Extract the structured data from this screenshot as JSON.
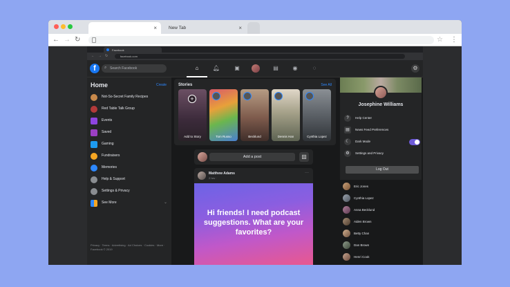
{
  "outer_browser": {
    "tabs": [
      {
        "label": ""
      },
      {
        "label": "New Tab"
      }
    ]
  },
  "inner_browser": {
    "tab_label": "Facebook",
    "url": "facebook.com"
  },
  "header": {
    "search_placeholder": "Search Facebook"
  },
  "sidebar": {
    "title": "Home",
    "create_label": "Create",
    "items": [
      {
        "label": "Not-So-Secret Family Recipes",
        "icon": "group-avatar-icon",
        "color": "#c98a4b"
      },
      {
        "label": "Red Table Talk Group",
        "icon": "group-avatar-icon",
        "color": "#b23a3a"
      },
      {
        "label": "Events",
        "icon": "calendar-icon",
        "color": "#8e44e0"
      },
      {
        "label": "Saved",
        "icon": "bookmark-icon",
        "color": "#9b3fc4"
      },
      {
        "label": "Gaming",
        "icon": "gamepad-icon",
        "color": "#1d9bf0"
      },
      {
        "label": "Fundraisers",
        "icon": "heart-icon",
        "color": "#f5a623"
      },
      {
        "label": "Memories",
        "icon": "clock-icon",
        "color": "#2d88ff"
      },
      {
        "label": "Help & Support",
        "icon": "help-icon",
        "color": "#8a8d91"
      },
      {
        "label": "Settings & Privacy",
        "icon": "gear-icon",
        "color": "#8a8d91"
      },
      {
        "label": "See More",
        "icon": "more-icon",
        "color": "#3a3b3c"
      }
    ],
    "footer": "Privacy · Terms · Advertising · Ad Choices · Cookies · More · Facebook © 2019"
  },
  "stories": {
    "title": "Stories",
    "see_all": "See All",
    "items": [
      {
        "name": "Add to Story"
      },
      {
        "name": "Tom Russo"
      },
      {
        "name": "Becklund"
      },
      {
        "name": "Dennis Han"
      },
      {
        "name": "Cynthia Lopez"
      }
    ]
  },
  "composer": {
    "button_label": "Add a post"
  },
  "post": {
    "author": "Matthew Adams",
    "meta": "2 hrs · ",
    "text": "Hi friends! I need podcast suggestions. What are your favorites?"
  },
  "account_menu": {
    "name": "Josephine Williams",
    "items": [
      {
        "label": "Help Center",
        "icon": "help-icon"
      },
      {
        "label": "News Feed Preferences",
        "icon": "news-feed-icon"
      },
      {
        "label": "Dark Mode",
        "icon": "moon-icon",
        "toggle": true
      },
      {
        "label": "Settings and Privacy",
        "icon": "gear-icon"
      }
    ],
    "logout_label": "Log Out"
  },
  "contacts": [
    {
      "name": "Eric Jones"
    },
    {
      "name": "Cynthia Lopez"
    },
    {
      "name": "Anna Becklund"
    },
    {
      "name": "Aiden Brown"
    },
    {
      "name": "Betty Chan"
    },
    {
      "name": "Dan Brown"
    },
    {
      "name": "Henri Cook"
    }
  ]
}
